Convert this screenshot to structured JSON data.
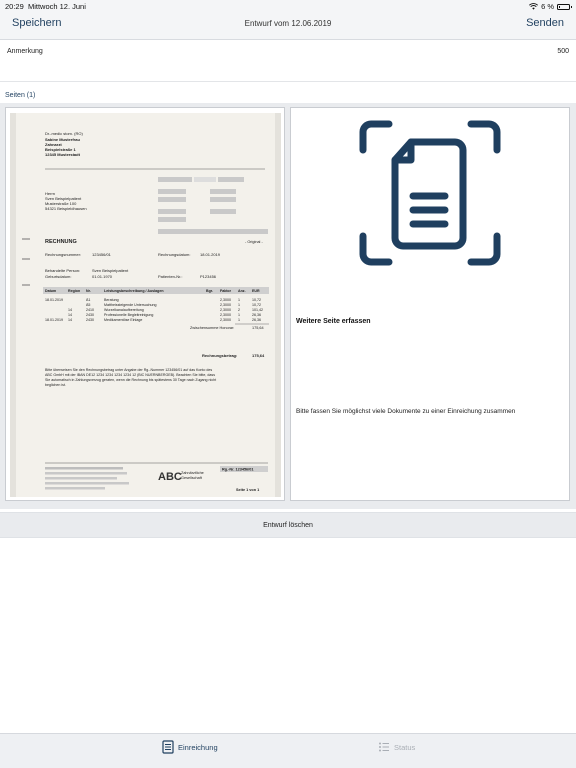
{
  "statusbar": {
    "time": "20:29",
    "date": "Mittwoch 12. Juni",
    "battery": "6 %"
  },
  "navbar": {
    "save_label": "Speichern",
    "title": "Entwurf vom 12.06.2019",
    "send_label": "Senden"
  },
  "note": {
    "label": "Anmerkung",
    "char_count": "500"
  },
  "pages": {
    "label": "Seiten  (1)"
  },
  "document": {
    "sender_name": "Dr.-medic stom. (RO)",
    "sender_sub1": "Sabine Musterfrau",
    "sender_sub2": "Zahnarzt",
    "sender_street": "Beispielstraße 1",
    "sender_city": "12345 Musterstadt",
    "recipient_line1": "Herrn",
    "recipient_line2": "Sven Beispielpatient",
    "recipient_line3": "Musterstraße 100",
    "recipient_line4": "54321 Beispieldhausen",
    "heading": "RECHNUNG",
    "original_label": "- Original -",
    "invoice_no_label": "Rechnungsnummer:",
    "invoice_no": "123456/01",
    "invoice_date_label": "Rechnungsdatum:",
    "invoice_date": "18.01.2019",
    "patient_label": "Behandelte Person:",
    "patient": "Sven Beispielpatient",
    "dob_label": "Geburtsdatum:",
    "dob": "01.01.1970",
    "patient_no_label": "Patienten-Nr.:",
    "patient_no": "P123456",
    "columns": [
      "Datum",
      "Region",
      "Nr.",
      "Leistungsbeschreibung / Auslagen",
      "Bgr.",
      "Faktor",
      "Anz.",
      "EUR"
    ],
    "rows": [
      [
        "18.01.2019",
        "",
        "Ä1",
        "Beratung",
        "",
        "2,3000",
        "1",
        "10,72"
      ],
      [
        "",
        "",
        "Ä5",
        "Mattheissteigende Untersuchung",
        "",
        "2,3000",
        "1",
        "10,72"
      ],
      [
        "",
        "14",
        "2410",
        "Wurzelkanalaufbereitung",
        "",
        "2,3000",
        "2",
        "101,42"
      ],
      [
        "",
        "14",
        "2430",
        "Professionelle Begleitreinigung",
        "",
        "2,3000",
        "1",
        "26,36"
      ],
      [
        "18.01.2019",
        "14",
        "2430",
        "Medikamentöse Einlage",
        "",
        "2,3000",
        "1",
        "26,36"
      ]
    ],
    "subtotal_label": "Zwischensumme Honorar:",
    "subtotal": "175,64",
    "total_label": "Rechnungsbetrag:",
    "total": "175,64",
    "payment_line1": "Bitte überweisen Sie den Rechnungsbetrag unter Angabe der Rg.-Nummer 123456/01 auf das Konto des",
    "payment_line2": "ABC GmbH mit der IBAN DE12 1234 1234 1234 1234 12 (BIC NUERNBERGEB). Beachten Sie bitte, dass",
    "payment_line3": "Sie automatisch in Zahlungsverzug geraten, wenn die Rechnung bis spätestens 30 Tage nach Zugang nicht",
    "payment_line4": "beglichen ist.",
    "footer_brand": "ABC",
    "footer_company1": "Zahnärztliche",
    "footer_company2": "Gesellschaft",
    "footer_ref": "Rg.-Nr. 123456/01",
    "footer_page": "Seite 1 von 1"
  },
  "add_page": {
    "title": "Weitere Seite erfassen",
    "hint": "Bitte fassen Sie möglichst viele Dokumente zu einer Einreichung zusammen",
    "icon_color": "#1f3f5f"
  },
  "actions": {
    "delete_label": "Entwurf löschen"
  },
  "tabs": [
    {
      "label": "Einreichung",
      "active": true
    },
    {
      "label": "Status",
      "active": false
    }
  ],
  "colors": {
    "accent": "#1f3f5f",
    "inactive": "#a9aeb5",
    "background_gray": "#e9ebee"
  }
}
